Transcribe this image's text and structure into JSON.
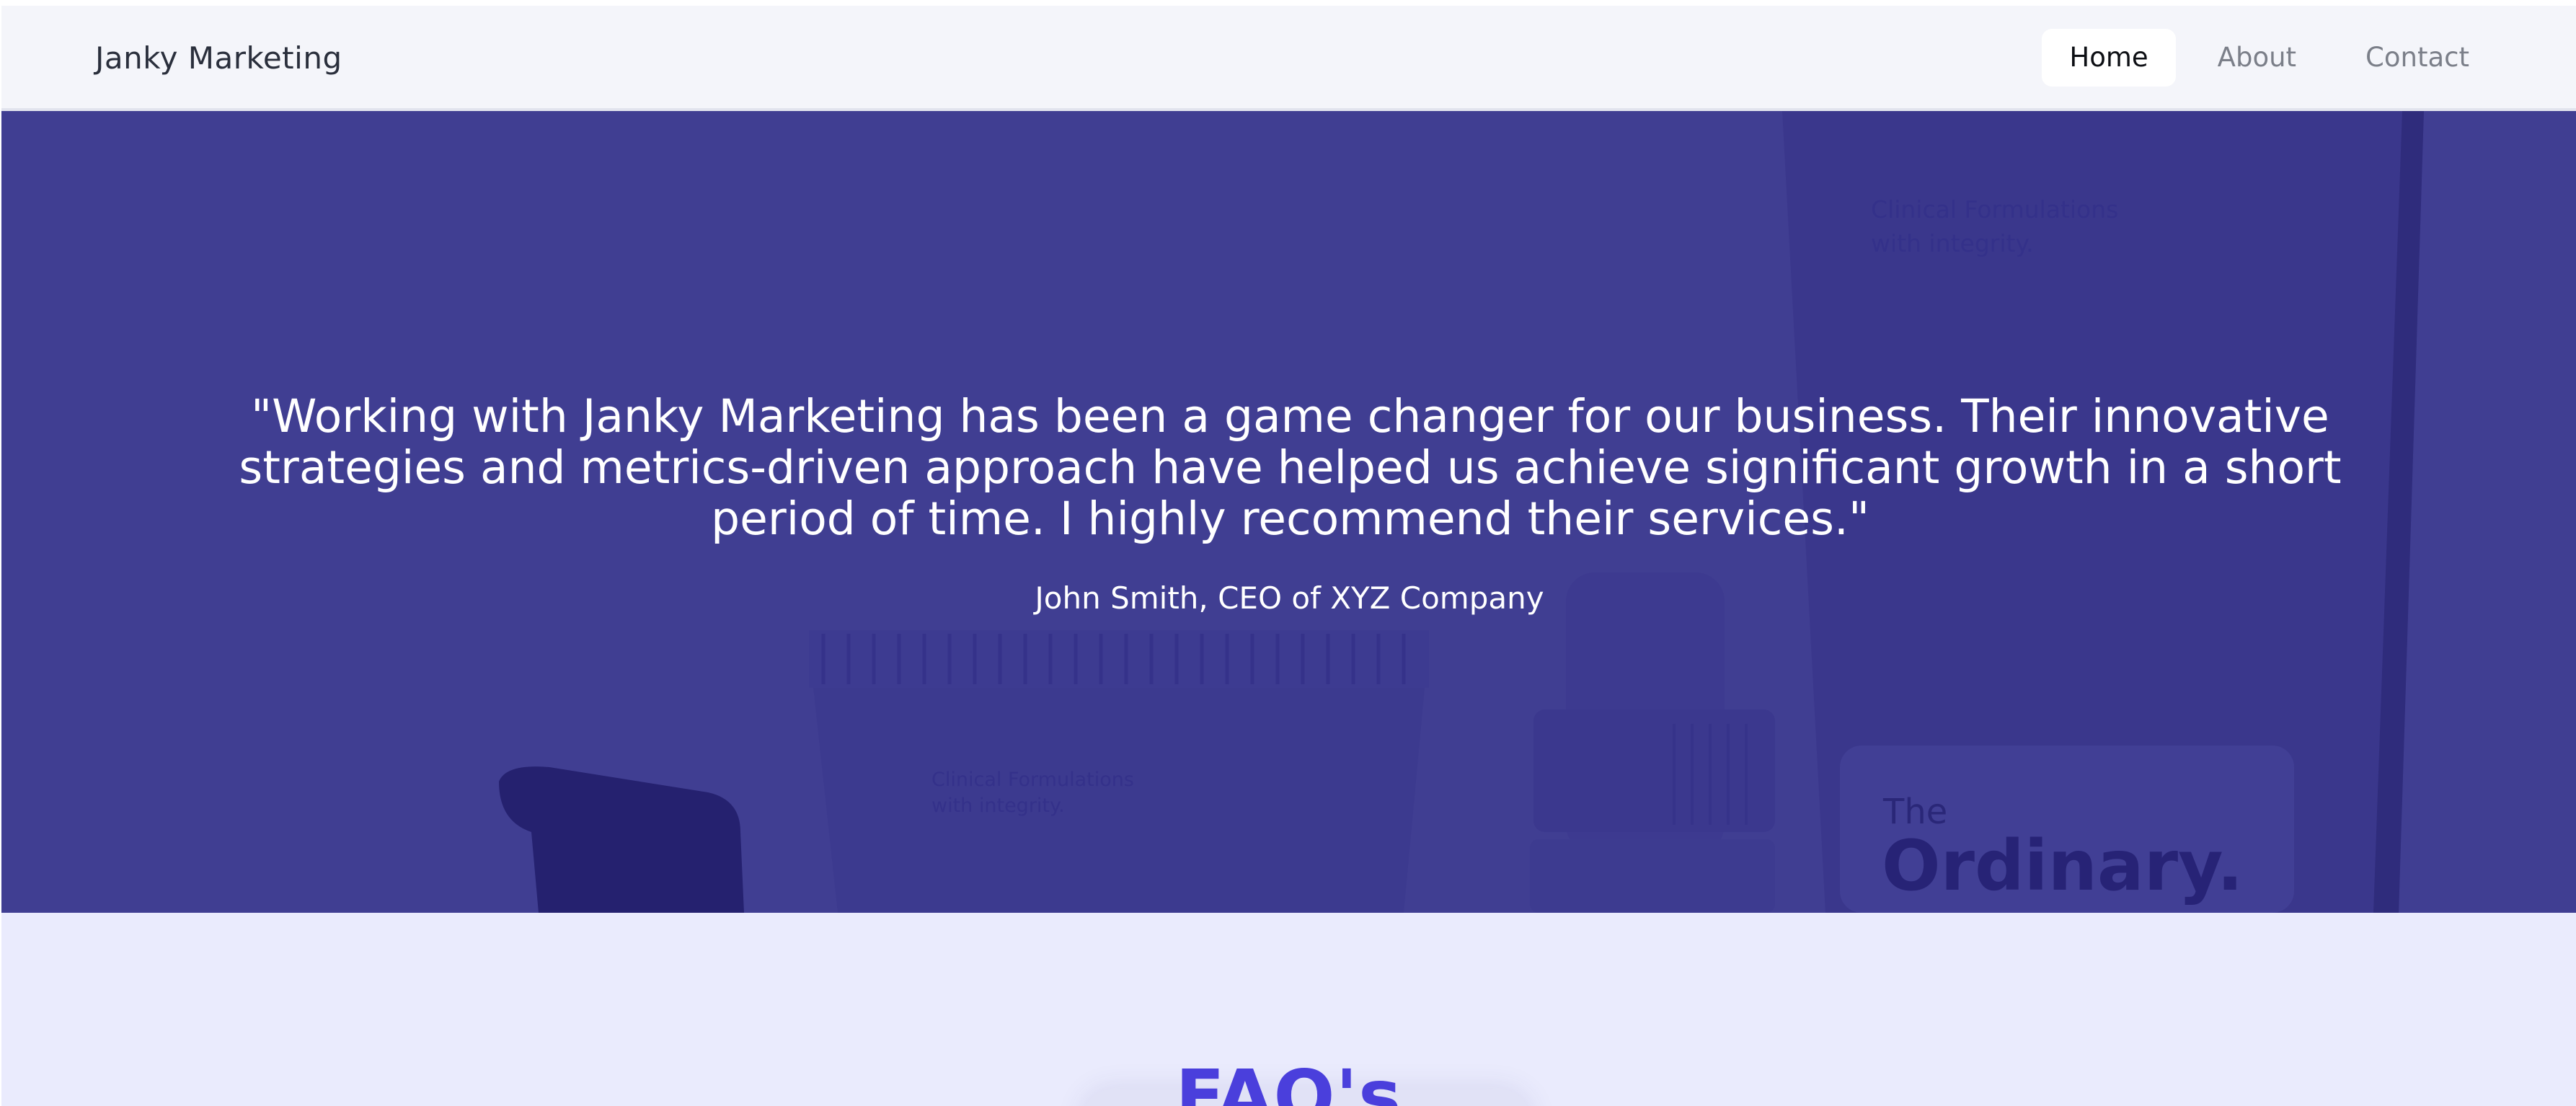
{
  "navbar": {
    "brand": "Janky Marketing",
    "links": [
      {
        "label": "Home",
        "active": true
      },
      {
        "label": "About",
        "active": false
      },
      {
        "label": "Contact",
        "active": false
      }
    ]
  },
  "hero": {
    "quote_lines": [
      "\"Working with Janky Marketing has been a game changer for our business. Their innovative",
      "strategies and metrics-driven approach have helped us achieve significant growth in a short",
      "period of time. I highly recommend their services.\""
    ],
    "author": "John Smith, CEO of XYZ Company",
    "background_image": {
      "tube_label": "Clinical Formulations with integrity.",
      "product_label_line1": "Clinical Formulations",
      "product_label_line2": "with integrity.",
      "brand_small": "The",
      "brand_large": "Ordinary."
    },
    "overlay_color": "#3f3d91"
  },
  "faq": {
    "title": "FAQ's",
    "title_color": "#4a3fdc"
  }
}
